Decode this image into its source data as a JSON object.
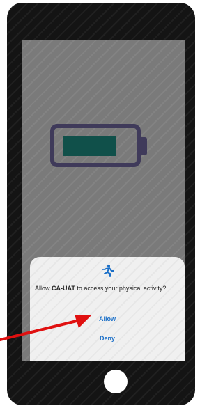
{
  "permission_dialog": {
    "message_prefix": "Allow ",
    "app_name": "CA-UAT",
    "message_suffix": " to access your physical activity?",
    "allow_label": "Allow",
    "deny_label": "Deny",
    "icon": "directions-walk-icon",
    "accent_color": "#1a6fc8"
  },
  "battery": {
    "icon": "battery-icon",
    "fill_color": "#10504a",
    "outline_color": "#3f3a5a"
  },
  "annotation": {
    "icon": "red-arrow-icon",
    "color": "#e01010"
  }
}
